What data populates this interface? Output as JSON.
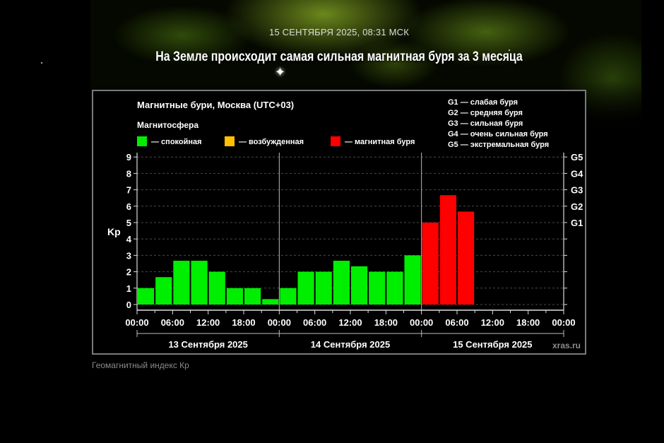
{
  "article": {
    "timestamp": "15 СЕНТЯБРЯ 2025, 08:31 МСК",
    "headline": "На Земле происходит самая сильная магнитная буря за 3 месяца",
    "image_caption": "Геомагнитный индекс Кр"
  },
  "colors": {
    "quiet": "#00ee00",
    "excited": "#ffc000",
    "storm": "#ff0000"
  },
  "chart_data": {
    "type": "bar",
    "title": "Магнитные бури, Москва (UTC+03)",
    "ylabel": "Kp",
    "ylim": [
      0,
      9
    ],
    "yticks": [
      "0",
      "1",
      "2",
      "3",
      "4",
      "5",
      "6",
      "7",
      "8",
      "9"
    ],
    "legend_title": "Магнитосфера",
    "legend": [
      {
        "label": "— спокойная",
        "color": "#00ee00"
      },
      {
        "label": "— возбужденная",
        "color": "#ffc000"
      },
      {
        "label": "— магнитная буря",
        "color": "#ff0000"
      }
    ],
    "g_scale": [
      "G1 — слабая буря",
      "G2 — средняя буря",
      "G3 — сильная буря",
      "G4 — очень сильная буря",
      "G5 — экстремальная буря"
    ],
    "right_axis": [
      {
        "label": "G1",
        "kp": 5
      },
      {
        "label": "G2",
        "kp": 6
      },
      {
        "label": "G3",
        "kp": 7
      },
      {
        "label": "G4",
        "kp": 8
      },
      {
        "label": "G5",
        "kp": 9
      }
    ],
    "x_tick_labels": [
      "00:00",
      "06:00",
      "12:00",
      "18:00",
      "00:00",
      "06:00",
      "12:00",
      "18:00",
      "00:00",
      "06:00",
      "12:00",
      "18:00",
      "00:00"
    ],
    "days": [
      "13 Сентября 2025",
      "14 Сентября 2025",
      "15 Сентября 2025"
    ],
    "interval_hours": 3,
    "values": [
      1,
      1.67,
      2.67,
      2.67,
      2,
      1,
      1,
      0.33,
      1,
      2,
      2,
      2.67,
      2.33,
      2,
      2,
      3,
      5,
      6.67,
      5.67
    ],
    "value_status": [
      "quiet",
      "quiet",
      "quiet",
      "quiet",
      "quiet",
      "quiet",
      "quiet",
      "quiet",
      "quiet",
      "quiet",
      "quiet",
      "quiet",
      "quiet",
      "quiet",
      "quiet",
      "quiet",
      "storm",
      "storm",
      "storm"
    ],
    "watermark": "xras.ru",
    "grid": true
  }
}
